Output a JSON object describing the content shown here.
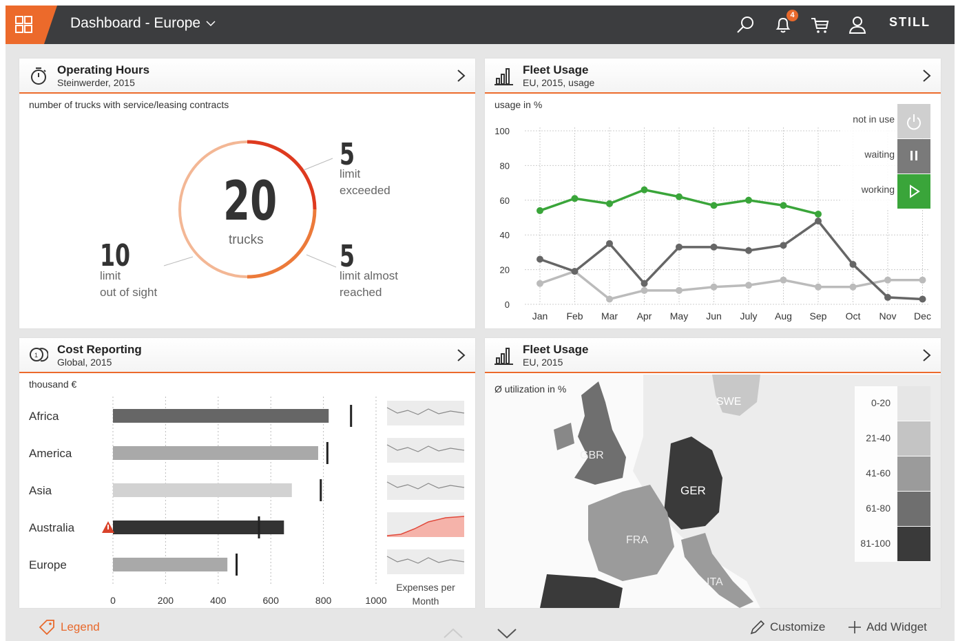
{
  "header": {
    "title": "Dashboard - Europe",
    "notification_count": "4",
    "brand": "STILL",
    "accent": "#ec6a2b",
    "icons": [
      "grid-icon",
      "search-icon",
      "bell-icon",
      "cart-icon",
      "user-icon"
    ]
  },
  "operating_hours": {
    "title": "Operating Hours",
    "subtitle": "Steinwerder, 2015",
    "caption": "number of trucks with service/leasing contracts",
    "total": "20",
    "total_label": "trucks",
    "exceeded": {
      "value": "5",
      "label": "limit\nexceeded"
    },
    "almost": {
      "value": "5",
      "label": "limit almost\nreached"
    },
    "out": {
      "value": "10",
      "label": "limit\nout of sight"
    }
  },
  "fleet_usage": {
    "title": "Fleet Usage",
    "subtitle": "EU, 2015, usage",
    "caption": "usage in %",
    "legend": [
      {
        "label": "not in use",
        "icon": "power-icon"
      },
      {
        "label": "waiting",
        "icon": "pause-icon"
      },
      {
        "label": "working",
        "icon": "play-icon"
      }
    ]
  },
  "cost": {
    "title": "Cost Reporting",
    "subtitle": "Global, 2015",
    "caption": "thousand €",
    "footer": "Expenses per\nMonth"
  },
  "fleet_map": {
    "title": "Fleet Usage",
    "subtitle": "EU, 2015",
    "caption": "Ø utilization in %",
    "legend": [
      "0-20",
      "21-40",
      "41-60",
      "61-80",
      "81-100"
    ],
    "legend_colors": [
      "#e6e6e6",
      "#c4c4c4",
      "#9b9b9b",
      "#6f6f6f",
      "#3a3a3a"
    ],
    "countries": [
      "SWE",
      "GBR",
      "GER",
      "FRA",
      "ITA"
    ]
  },
  "footer": {
    "legend": "Legend",
    "customize": "Customize",
    "add_widget": "Add Widget"
  },
  "chart_data": [
    {
      "type": "line",
      "title": "",
      "ylabel": "usage in %",
      "ylim": [
        0,
        100
      ],
      "grid": true,
      "x": [
        "Jan",
        "Feb",
        "Mar",
        "Apr",
        "May",
        "Jun",
        "July",
        "Aug",
        "Sep",
        "Oct",
        "Nov",
        "Dec"
      ],
      "series": [
        {
          "name": "working",
          "color": "#3aa53a",
          "values": [
            54,
            61,
            58,
            66,
            62,
            57,
            60,
            57,
            52,
            null,
            null,
            null
          ]
        },
        {
          "name": "waiting",
          "color": "#666666",
          "values": [
            26,
            19,
            35,
            12,
            33,
            33,
            31,
            34,
            48,
            23,
            4,
            3
          ]
        },
        {
          "name": "not in use",
          "color": "#bbbbbb",
          "values": [
            12,
            19,
            3,
            8,
            8,
            10,
            11,
            14,
            10,
            10,
            14,
            14
          ]
        }
      ]
    },
    {
      "type": "bar",
      "title": "",
      "xlabel": "",
      "ylabel": "thousand €",
      "xlim": [
        0,
        1000
      ],
      "ticks": [
        0,
        200,
        400,
        600,
        800,
        1000
      ],
      "categories": [
        "Africa",
        "America",
        "Asia",
        "Australia",
        "Europe"
      ],
      "values": [
        820,
        780,
        680,
        650,
        435
      ],
      "targets": [
        905,
        815,
        790,
        555,
        470
      ],
      "colors": [
        "#666666",
        "#a9a9a9",
        "#d2d2d2",
        "#333333",
        "#a9a9a9"
      ],
      "alert": [
        false,
        false,
        false,
        true,
        false
      ]
    }
  ]
}
